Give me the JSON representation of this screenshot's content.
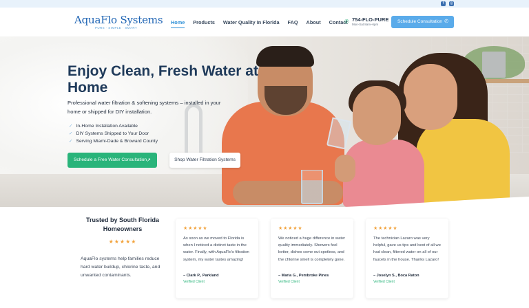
{
  "header": {
    "logo_brand": "AquaFlo Systems",
    "logo_tagline": "PURE · SIMPLE · SMART",
    "nav": [
      {
        "label": "Home",
        "active": true
      },
      {
        "label": "Products",
        "active": false
      },
      {
        "label": "Water Quality In Florida",
        "active": false
      },
      {
        "label": "FAQ",
        "active": false
      },
      {
        "label": "About",
        "active": false
      },
      {
        "label": "Contact",
        "active": false
      }
    ],
    "phone_number": "754-FLO-PURE",
    "phone_hours": "Mon-Sat 8am–6pm",
    "cta_label": "Schedule Consultation"
  },
  "social": [
    "facebook-icon",
    "instagram-icon"
  ],
  "hero": {
    "title": "Enjoy Clean, Fresh Water at Home",
    "subtitle": "Professional water filtration & softening systems – installed in your home or shipped for DIY installation.",
    "bullets": [
      "In-Home Installation Available",
      "DIY Systems Shipped to Your Door",
      "Serving Miami-Dade & Broward County"
    ],
    "primary_button": "Schedule a Free Water Consultation",
    "secondary_button": "Shop Water Filtration Systems"
  },
  "trust": {
    "title": "Trusted by South Florida Homeowners",
    "stars": "★★★★★",
    "description": "AquaFlo systems help families reduce hard water buildup, chlorine taste, and unwanted contaminants."
  },
  "testimonials": [
    {
      "stars": "★★★★★",
      "text": "As soon as we moved to Florida is when I noticed a distinct taste in the water. Finally, with AquaFlo's filtration system, my water tastes amazing!",
      "author": "– Clark P., Parkland",
      "verified": "Verified Client"
    },
    {
      "stars": "★★★★★",
      "text": "We noticed a huge difference in water quality immediately. Showers feel better, dishes come out spotless, and the chlorine smell is completely gone.",
      "author": "– Maria G., Pembroke Pines",
      "verified": "Verified Client"
    },
    {
      "stars": "★★★★★",
      "text": "The technician Lazaro was very helpful, gave us tips and best of all we had clean, filtered water on all of our faucets in the house. Thanks Lazaro!",
      "author": "– Joselyn S., Boca Raton",
      "verified": "Verified Client"
    }
  ],
  "colors": {
    "brand_blue": "#1d63b3",
    "accent_blue": "#5aabea",
    "green": "#29b47a",
    "star": "#f2a23b"
  }
}
